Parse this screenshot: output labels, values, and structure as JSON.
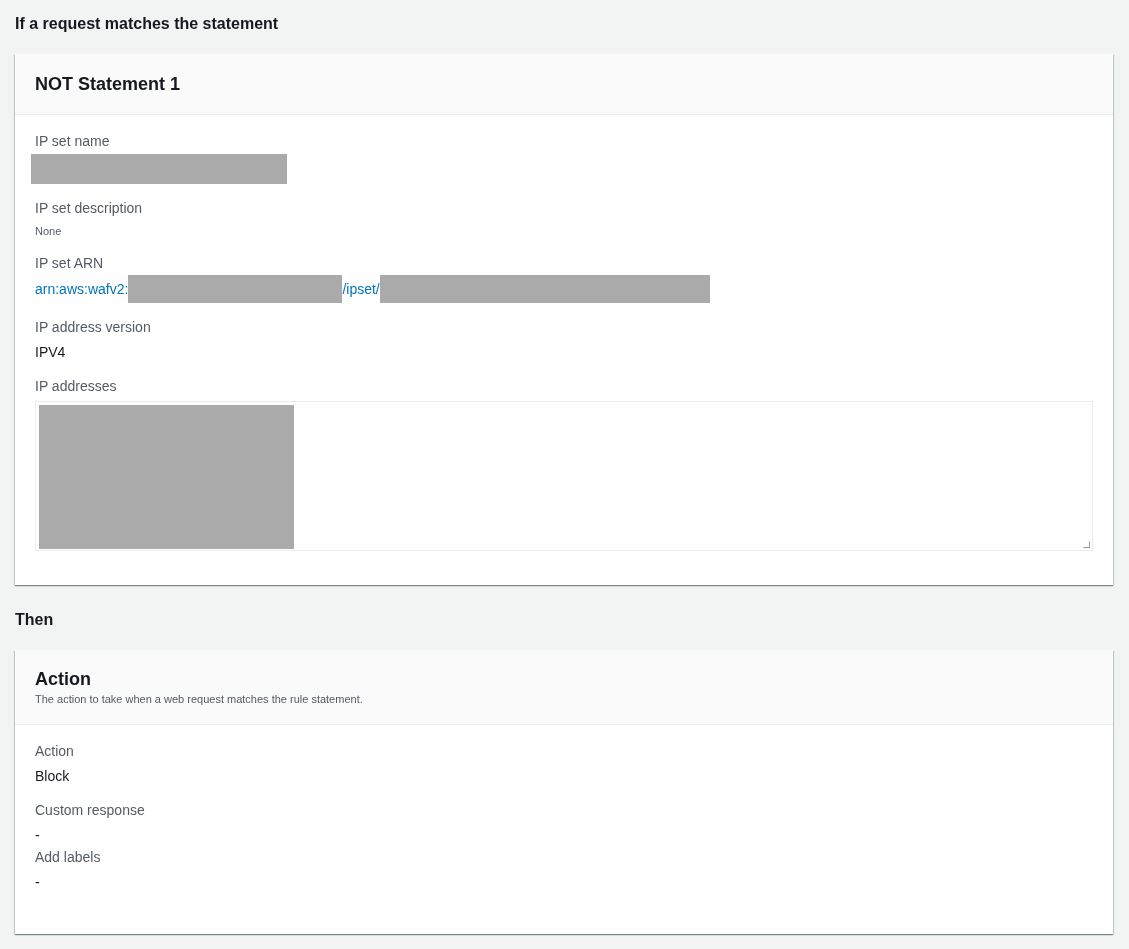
{
  "sections": [
    {
      "heading": "If a request matches the statement",
      "card": {
        "title": "NOT Statement 1",
        "fields": [
          {
            "label": "IP set name",
            "kind": "redacted"
          },
          {
            "label": "IP set description",
            "kind": "small",
            "value": "None"
          },
          {
            "label": "IP set ARN",
            "kind": "link",
            "segments": [
              {
                "kind": "text",
                "text": "arn:aws:wafv2:"
              },
              {
                "kind": "redacted"
              },
              {
                "kind": "text",
                "text": "/ipset/"
              },
              {
                "kind": "redacted"
              }
            ]
          },
          {
            "label": "IP address version",
            "kind": "text",
            "value": "IPV4"
          },
          {
            "label": "IP addresses",
            "kind": "textarea"
          }
        ]
      }
    },
    {
      "heading": "Then",
      "card": {
        "title": "Action",
        "description": "The action to take when a web request matches the rule statement.",
        "fields": [
          {
            "label": "Action",
            "kind": "text",
            "value": "Block"
          },
          {
            "label": "Custom response",
            "kind": "tight",
            "value": "-"
          },
          {
            "label": "Add labels",
            "kind": "text",
            "value": "-"
          }
        ]
      }
    }
  ]
}
